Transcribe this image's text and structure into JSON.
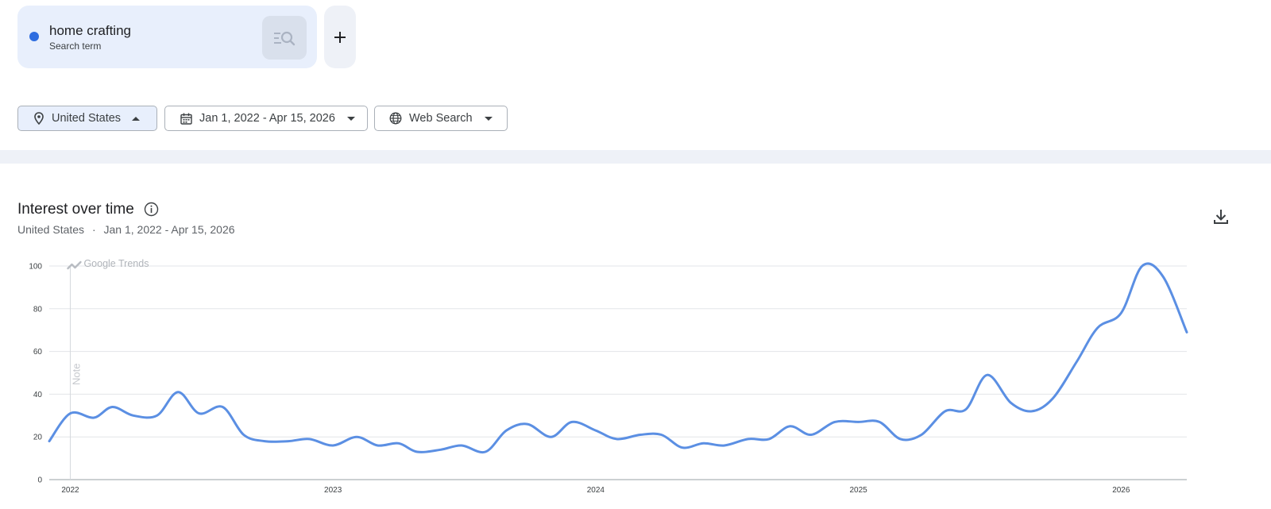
{
  "search_term": {
    "name": "home crafting",
    "type_label": "Search term",
    "color": "#2e6de0"
  },
  "filters": {
    "region": "United States",
    "date_range": "Jan 1, 2022 - Apr 15, 2026",
    "property": "Web Search"
  },
  "chart_header": {
    "title": "Interest over time",
    "subtitle_region": "United States",
    "subtitle_separator": "·",
    "subtitle_range": "Jan 1, 2022 - Apr 15, 2026"
  },
  "icons": {
    "term_dot": "color-dot-icon",
    "term_search": "search-list-icon",
    "add": "plus-icon",
    "region": "location-pin-icon",
    "date": "calendar-icon",
    "property": "globe-icon",
    "info": "info-icon",
    "download": "download-icon",
    "watermark": "trends-logo-icon"
  },
  "chart_data": {
    "type": "line",
    "title": "Interest over time",
    "watermark": "Google Trends",
    "note_marker": "Note",
    "note_x": 2022.0,
    "ylim": [
      0,
      100
    ],
    "xlim": [
      2021.92,
      2026.25
    ],
    "y_ticks": [
      0,
      20,
      40,
      60,
      80,
      100
    ],
    "x_ticks": [
      {
        "label": "2022",
        "value": 2022
      },
      {
        "label": "2023",
        "value": 2023
      },
      {
        "label": "2024",
        "value": 2024
      },
      {
        "label": "2025",
        "value": 2025
      },
      {
        "label": "2026",
        "value": 2026
      }
    ],
    "grid": true,
    "line_color": "#5b8fe3",
    "series": [
      {
        "name": "home crafting",
        "x": [
          2021.92,
          2022.0,
          2022.09,
          2022.16,
          2022.24,
          2022.33,
          2022.41,
          2022.49,
          2022.58,
          2022.66,
          2022.74,
          2022.83,
          2022.91,
          2023.0,
          2023.09,
          2023.17,
          2023.25,
          2023.32,
          2023.41,
          2023.49,
          2023.58,
          2023.66,
          2023.74,
          2023.83,
          2023.91,
          2024.0,
          2024.08,
          2024.17,
          2024.25,
          2024.33,
          2024.41,
          2024.49,
          2024.58,
          2024.66,
          2024.74,
          2024.82,
          2024.91,
          2025.0,
          2025.08,
          2025.16,
          2025.24,
          2025.33,
          2025.41,
          2025.49,
          2025.58,
          2025.66,
          2025.74,
          2025.83,
          2025.91,
          2026.0,
          2026.08,
          2026.16,
          2026.25
        ],
        "values": [
          18,
          31,
          29,
          34,
          30,
          30,
          41,
          31,
          34,
          21,
          18,
          18,
          19,
          16,
          20,
          16,
          17,
          13,
          14,
          16,
          13,
          23,
          26,
          20,
          27,
          23,
          19,
          21,
          21,
          15,
          17,
          16,
          19,
          19,
          25,
          21,
          27,
          27,
          27,
          19,
          21,
          32,
          33,
          49,
          36,
          32,
          38,
          55,
          71,
          78,
          100,
          95,
          69
        ]
      }
    ]
  }
}
